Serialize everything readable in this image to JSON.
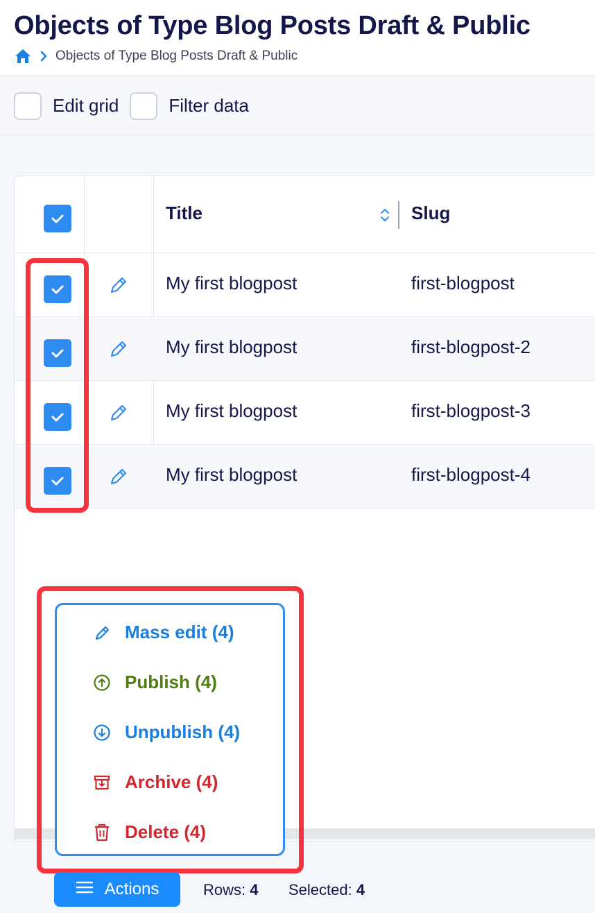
{
  "header": {
    "title": "Objects of Type Blog Posts Draft & Public",
    "breadcrumb": {
      "home_icon": "home-icon",
      "current": "Objects of Type Blog Posts Draft & Public"
    }
  },
  "toolbar": {
    "edit_grid_label": "Edit grid",
    "filter_data_label": "Filter data"
  },
  "grid": {
    "columns": [
      "Title",
      "Slug"
    ],
    "header_checked": true,
    "rows": [
      {
        "title": "My first blogpost",
        "slug": "first-blogpost",
        "checked": true
      },
      {
        "title": "My first blogpost",
        "slug": "first-blogpost-2",
        "checked": true
      },
      {
        "title": "My first blogpost",
        "slug": "first-blogpost-3",
        "checked": true
      },
      {
        "title": "My first blogpost",
        "slug": "first-blogpost-4",
        "checked": true
      }
    ]
  },
  "actions_menu": {
    "items": [
      {
        "label": "Mass edit (4)",
        "icon": "pencil-icon",
        "color": "#1a7fe0"
      },
      {
        "label": "Publish (4)",
        "icon": "arrow-up-circle-icon",
        "color": "#4e7d13"
      },
      {
        "label": "Unpublish (4)",
        "icon": "arrow-down-circle-icon",
        "color": "#1a7fe0"
      },
      {
        "label": "Archive (4)",
        "icon": "archive-icon",
        "color": "#d0282f"
      },
      {
        "label": "Delete (4)",
        "icon": "trash-icon",
        "color": "#d0282f"
      }
    ]
  },
  "footer": {
    "actions_label": "Actions",
    "rows_label": "Rows:",
    "rows_value": "4",
    "selected_label": "Selected:",
    "selected_value": "4"
  },
  "colors": {
    "accent": "#2e8cf0",
    "highlight": "#f5333f",
    "text": "#14174a"
  }
}
